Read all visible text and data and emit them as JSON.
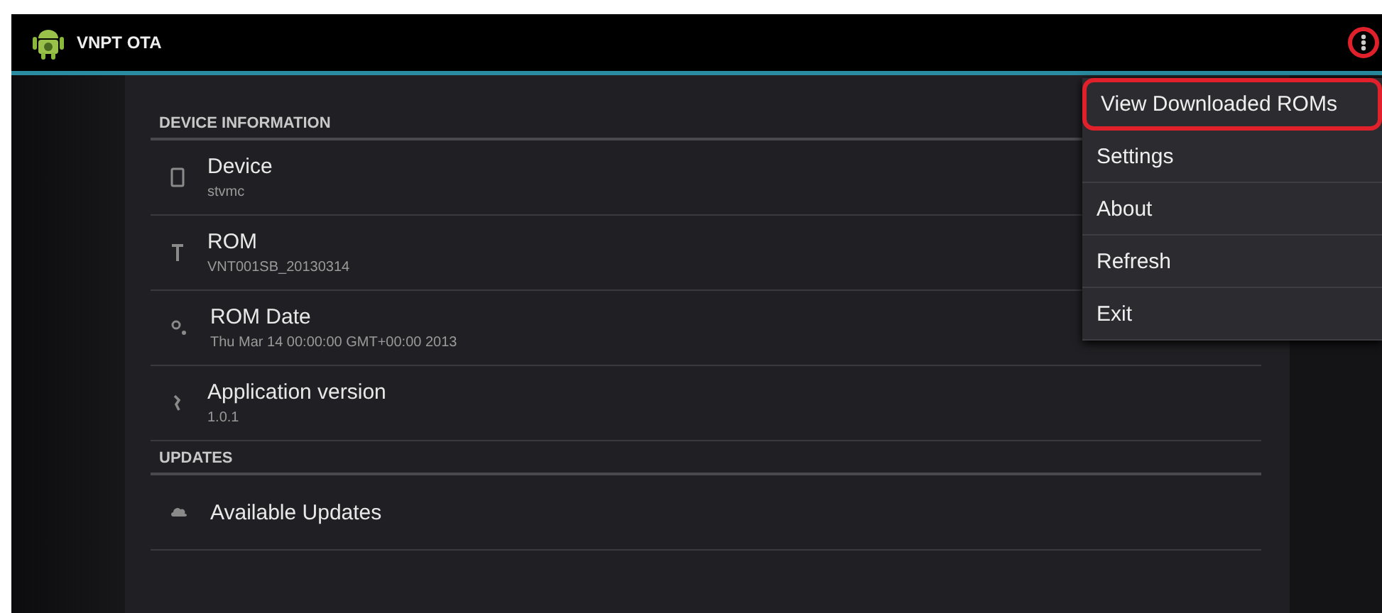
{
  "action_bar": {
    "title": "VNPT OTA",
    "overflow_highlighted": true
  },
  "sections": [
    {
      "header": "DEVICE INFORMATION",
      "items": [
        {
          "kind": "phone",
          "title": "Device",
          "summary": "stvmc"
        },
        {
          "kind": "antenna",
          "title": "ROM",
          "summary": "VNT001SB_20130314"
        },
        {
          "kind": "gears",
          "title": "ROM Date",
          "summary": "Thu Mar 14 00:00:00 GMT+00:00 2013"
        },
        {
          "kind": "wrench",
          "title": "Application version",
          "summary": "1.0.1"
        }
      ]
    },
    {
      "header": "UPDATES",
      "items": [
        {
          "kind": "cloud",
          "title": "Available Updates"
        }
      ]
    }
  ],
  "menu": [
    {
      "label": "View Downloaded ROMs",
      "highlighted": true
    },
    {
      "label": "Settings",
      "highlighted": false
    },
    {
      "label": "About",
      "highlighted": false
    },
    {
      "label": "Refresh",
      "highlighted": false
    },
    {
      "label": "Exit",
      "highlighted": false
    }
  ]
}
